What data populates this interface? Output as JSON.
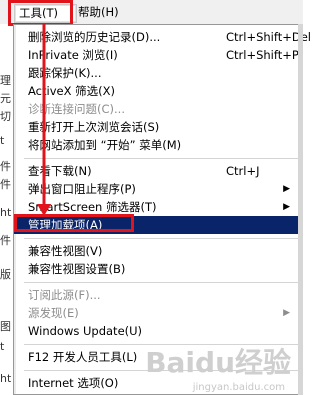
{
  "menubar": {
    "tools": "工具(T)",
    "help": "帮助(H)"
  },
  "background_chars": [
    "理",
    "元",
    "切",
    "t",
    "件",
    "件",
    "ht",
    "件",
    "版",
    "图",
    "t",
    "ht"
  ],
  "menu": [
    {
      "label": "删除浏览的历史记录(D)...",
      "shortcut": "Ctrl+Shift+Del",
      "disabled": false
    },
    {
      "label": "InPrivate 浏览(I)",
      "shortcut": "Ctrl+Shift+P",
      "disabled": false
    },
    {
      "label": "跟踪保护(K)...",
      "shortcut": "",
      "disabled": false
    },
    {
      "label": "ActiveX 筛选(X)",
      "shortcut": "",
      "disabled": false
    },
    {
      "label": "诊断连接问题(C)...",
      "shortcut": "",
      "disabled": true
    },
    {
      "label": "重新打开上次浏览会话(S)",
      "shortcut": "",
      "disabled": false
    },
    {
      "label": "将网站添加到 “开始” 菜单(M)",
      "shortcut": "",
      "disabled": false
    },
    {
      "label": "查看下载(N)",
      "shortcut": "Ctrl+J",
      "disabled": false
    },
    {
      "label": "弹出窗口阻止程序(P)",
      "shortcut": "",
      "disabled": false,
      "submenu": true
    },
    {
      "label": "SmartScreen 筛选器(T)",
      "shortcut": "",
      "disabled": false,
      "submenu": true
    },
    {
      "label": "管理加载项(A)",
      "shortcut": "",
      "disabled": false,
      "highlight": true
    },
    {
      "label": "兼容性视图(V)",
      "shortcut": "",
      "disabled": false
    },
    {
      "label": "兼容性视图设置(B)",
      "shortcut": "",
      "disabled": false
    },
    {
      "label": "订阅此源(F)...",
      "shortcut": "",
      "disabled": true
    },
    {
      "label": "源发现(E)",
      "shortcut": "",
      "disabled": true,
      "submenu": true
    },
    {
      "label": "Windows Update(U)",
      "shortcut": "",
      "disabled": false
    },
    {
      "label": "F12 开发人员工具(L)",
      "shortcut": "",
      "disabled": false
    },
    {
      "label": "Internet 选项(O)",
      "shortcut": "",
      "disabled": false
    }
  ],
  "submenu_arrow": "▶",
  "watermark": {
    "brand": "Baidu经验",
    "url": "jingyan.baidu.com"
  }
}
